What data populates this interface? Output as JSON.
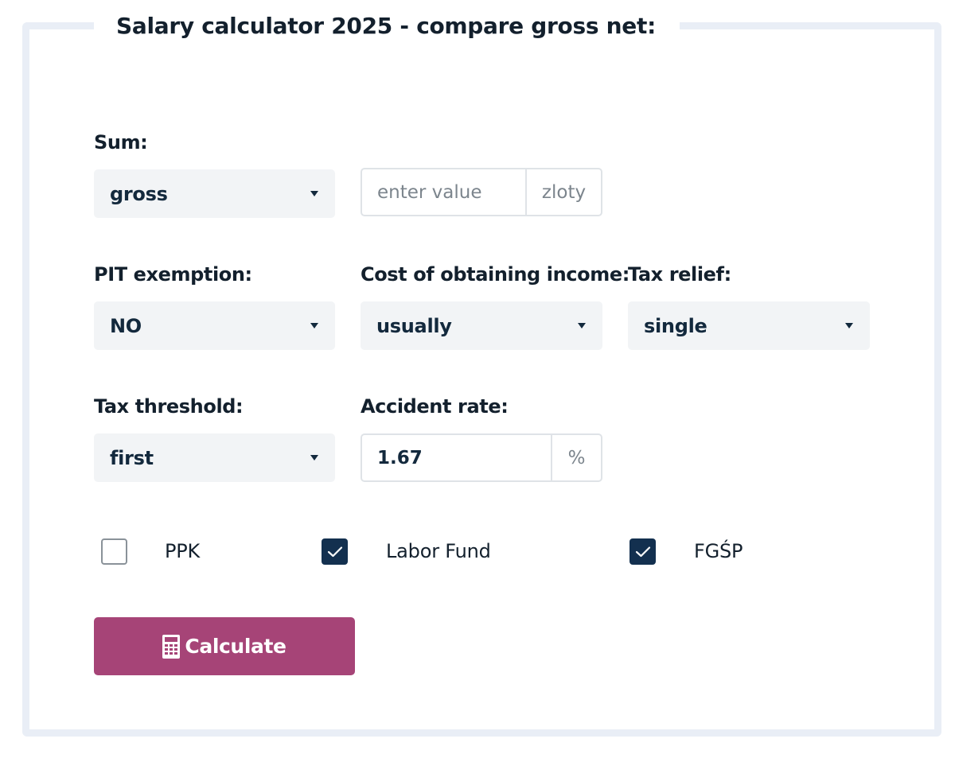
{
  "title": "Salary calculator 2025 - compare gross net:",
  "sum": {
    "label": "Sum:",
    "type_select": {
      "value": "gross"
    },
    "amount_input": {
      "value": "",
      "placeholder": "enter value",
      "unit": "zloty"
    }
  },
  "pit_exemption": {
    "label": "PIT exemption:",
    "value": "NO"
  },
  "cost_of_income": {
    "label": "Cost of obtaining income:",
    "value": "usually"
  },
  "tax_relief": {
    "label": "Tax relief:",
    "value": "single"
  },
  "tax_threshold": {
    "label": "Tax threshold:",
    "value": "first"
  },
  "accident_rate": {
    "label": "Accident rate:",
    "value": "1.67",
    "unit": "%"
  },
  "checkboxes": [
    {
      "label": "PPK",
      "checked": false
    },
    {
      "label": "Labor Fund",
      "checked": true
    },
    {
      "label": "FGŚP",
      "checked": true
    }
  ],
  "calculate_button": {
    "label": "Calculate",
    "icon": "calculator-icon"
  },
  "colors": {
    "accent": "#a64477",
    "checkbox_checked": "#13304f",
    "border": "#e9eef6",
    "select_bg": "#f2f4f6"
  }
}
